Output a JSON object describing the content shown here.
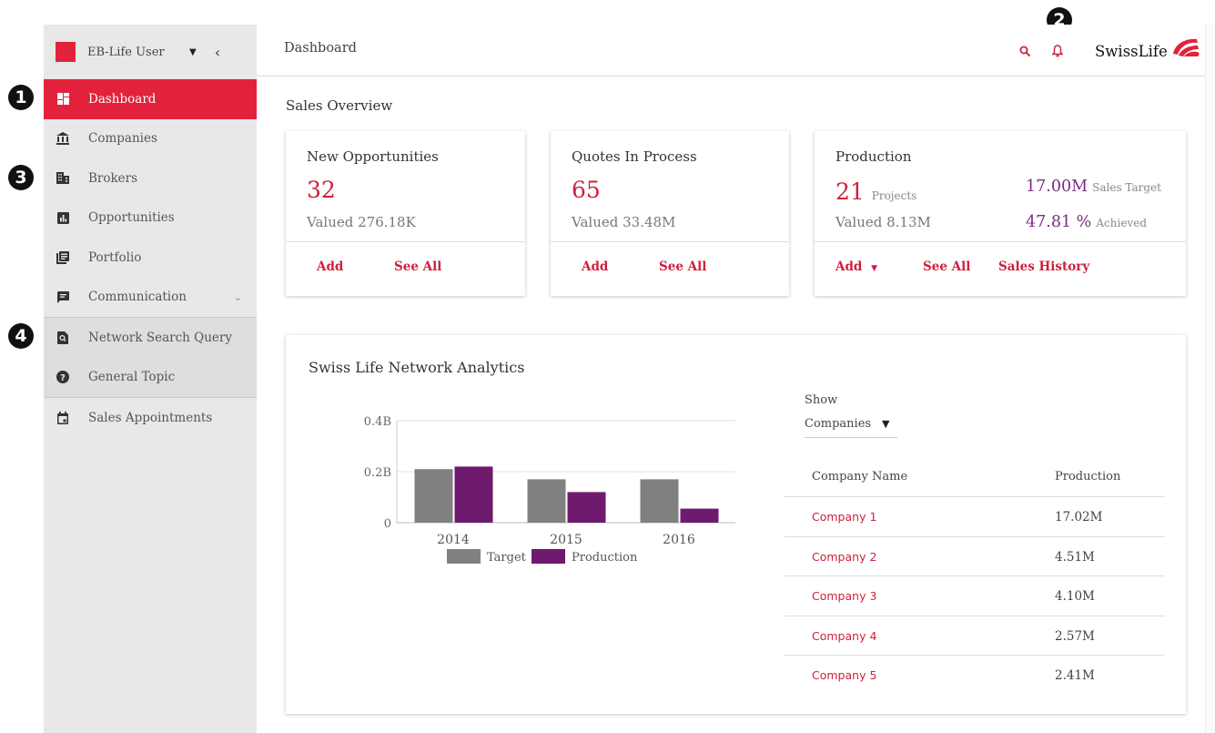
{
  "sidebar": {
    "user_name": "EB-Life User",
    "items": [
      {
        "label": "Dashboard",
        "icon": "dashboard-icon"
      },
      {
        "label": "Companies",
        "icon": "bank-icon"
      },
      {
        "label": "Brokers",
        "icon": "building-icon"
      },
      {
        "label": "Opportunities",
        "icon": "bar-chart-icon"
      },
      {
        "label": "Portfolio",
        "icon": "portfolio-icon"
      },
      {
        "label": "Communication",
        "icon": "message-icon"
      },
      {
        "label": "Network Search Query",
        "icon": "search-doc-icon"
      },
      {
        "label": "General Topic",
        "icon": "help-icon"
      },
      {
        "label": "Sales Appointments",
        "icon": "calendar-icon"
      }
    ]
  },
  "header": {
    "title": "Dashboard",
    "logo_text": "SwissLife"
  },
  "markers": [
    "1",
    "2",
    "3",
    "4"
  ],
  "overview": {
    "title": "Sales Overview",
    "new_opportunities": {
      "title": "New Opportunities",
      "count": "32",
      "valued": "Valued 276.18K",
      "add": "Add",
      "see_all": "See All"
    },
    "quotes": {
      "title": "Quotes In Process",
      "count": "65",
      "valued": "Valued 33.48M",
      "add": "Add",
      "see_all": "See All"
    },
    "production": {
      "title": "Production",
      "count": "21",
      "count_unit": "Projects",
      "valued": "Valued 8.13M",
      "target_value": "17.00M",
      "target_label": "Sales Target",
      "achieved_value": "47.81 %",
      "achieved_label": "Achieved",
      "add": "Add",
      "see_all": "See All",
      "history": "Sales History"
    }
  },
  "analytics": {
    "title": "Swiss Life Network Analytics",
    "show_label": "Show",
    "show_value": "Companies",
    "table_headers": [
      "Company Name",
      "Production"
    ],
    "rows": [
      {
        "name": "Company 1",
        "production": "17.02M"
      },
      {
        "name": "Company 2",
        "production": "4.51M"
      },
      {
        "name": "Company 3",
        "production": "4.10M"
      },
      {
        "name": "Company 4",
        "production": "2.57M"
      },
      {
        "name": "Company 5",
        "production": "2.41M"
      }
    ]
  },
  "chart_data": {
    "type": "bar",
    "categories": [
      "2014",
      "2015",
      "2016"
    ],
    "series": [
      {
        "name": "Target",
        "values": [
          0.21,
          0.17,
          0.17
        ],
        "color": "#808080"
      },
      {
        "name": "Production",
        "values": [
          0.22,
          0.12,
          0.055
        ],
        "color": "#6e1a6f"
      }
    ],
    "ylim": [
      0,
      0.4
    ],
    "yticks": [
      "0",
      "0.2B",
      "0.4B"
    ],
    "legend": "bottom",
    "grid": true
  },
  "colors": {
    "accent": "#e2223b",
    "purple": "#6e1a6f",
    "grey": "#808080"
  }
}
